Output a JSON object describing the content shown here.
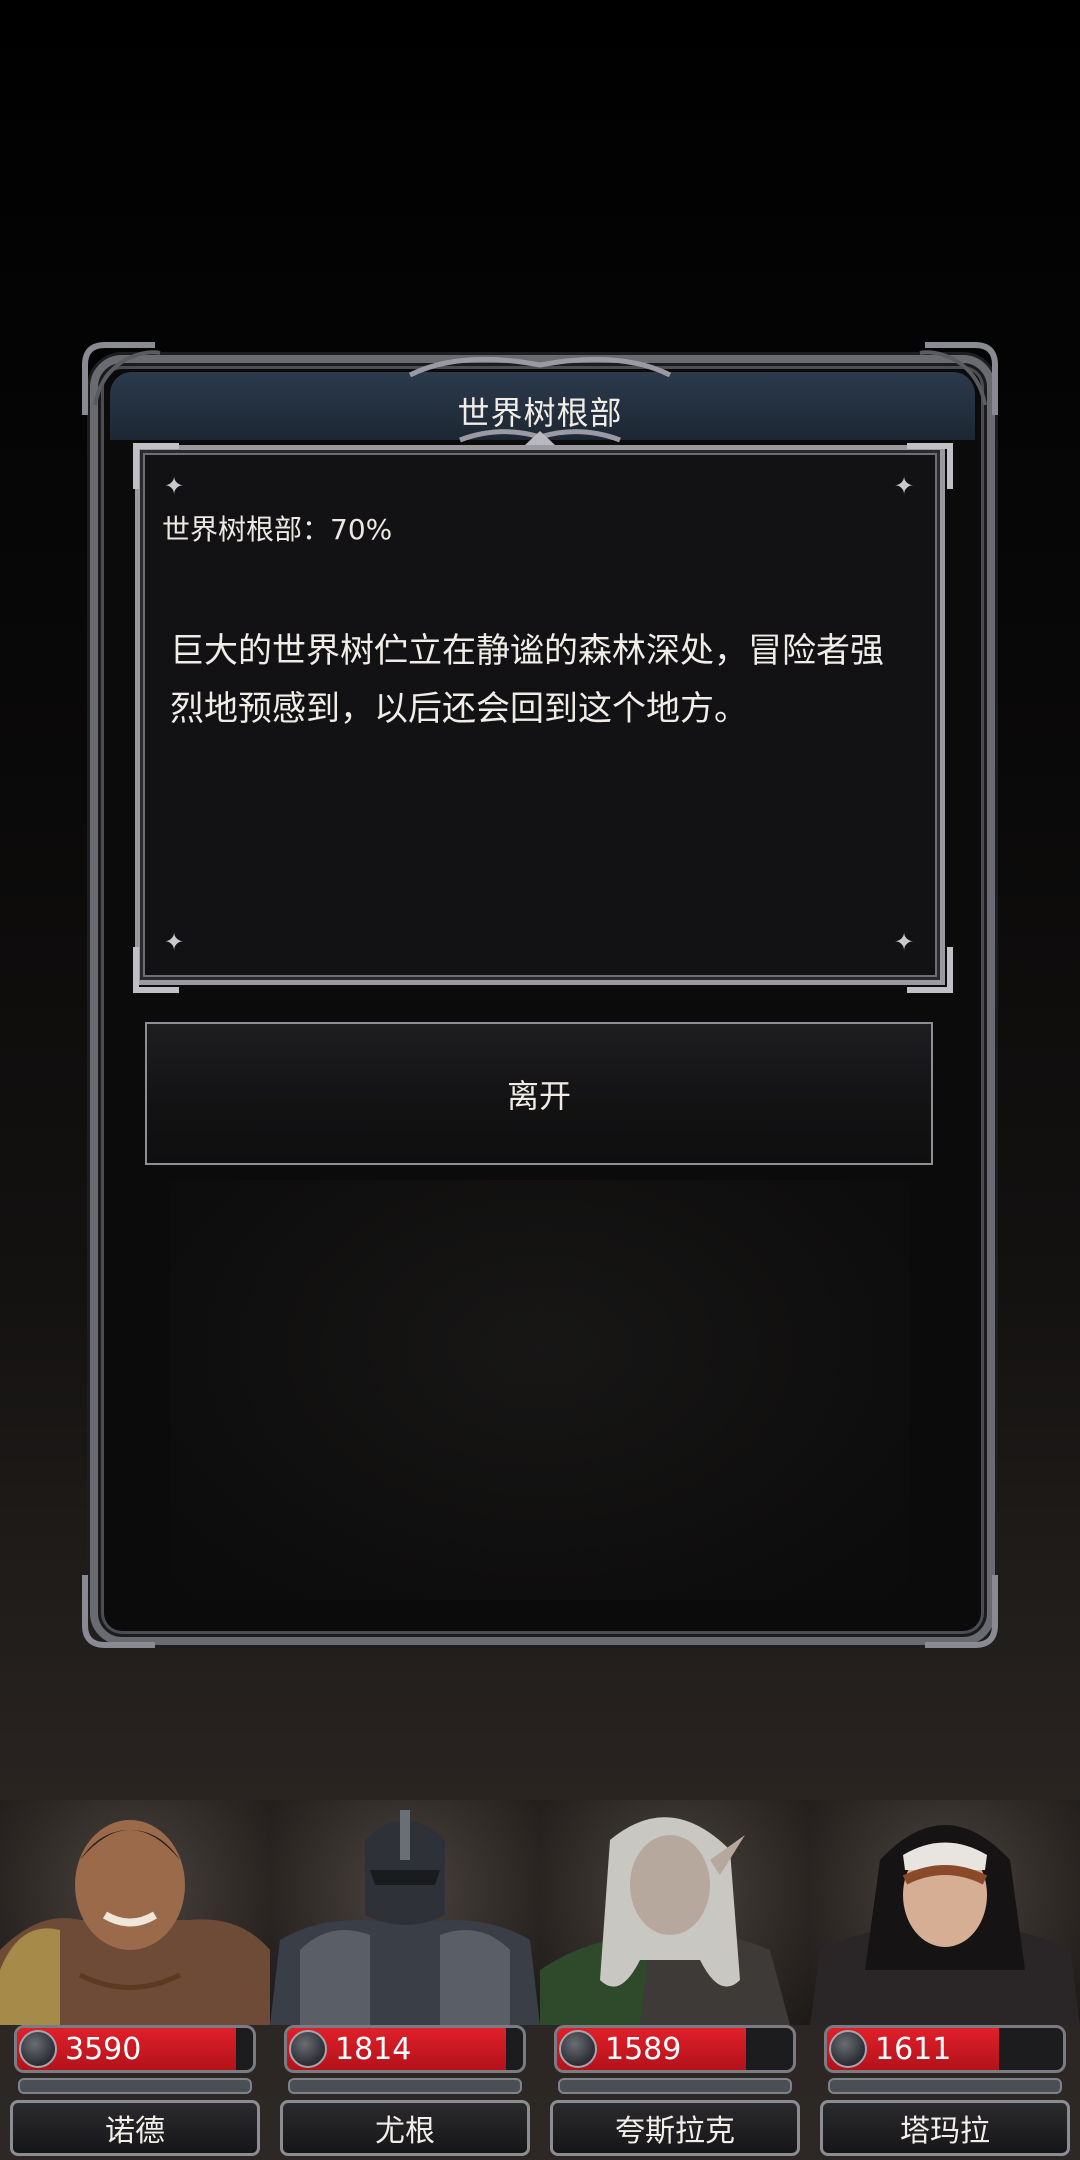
{
  "dialog": {
    "title": "世界树根部",
    "stat_line": "世界树根部：70%",
    "description": "巨大的世界树伫立在静谧的森林深处，冒险者强烈地预感到，以后还会回到这个地方。",
    "leave_button": "离开"
  },
  "party": [
    {
      "name": "诺德",
      "hp": "3590",
      "hp_fraction": 0.93
    },
    {
      "name": "尤根",
      "hp": "1814",
      "hp_fraction": 0.93
    },
    {
      "name": "夸斯拉克",
      "hp": "1589",
      "hp_fraction": 0.8
    },
    {
      "name": "塔玛拉",
      "hp": "1611",
      "hp_fraction": 0.73
    }
  ],
  "colors": {
    "hp_red": "#d81b24",
    "frame_silver": "#6a6b70",
    "title_blue": "#2b3a4c"
  }
}
